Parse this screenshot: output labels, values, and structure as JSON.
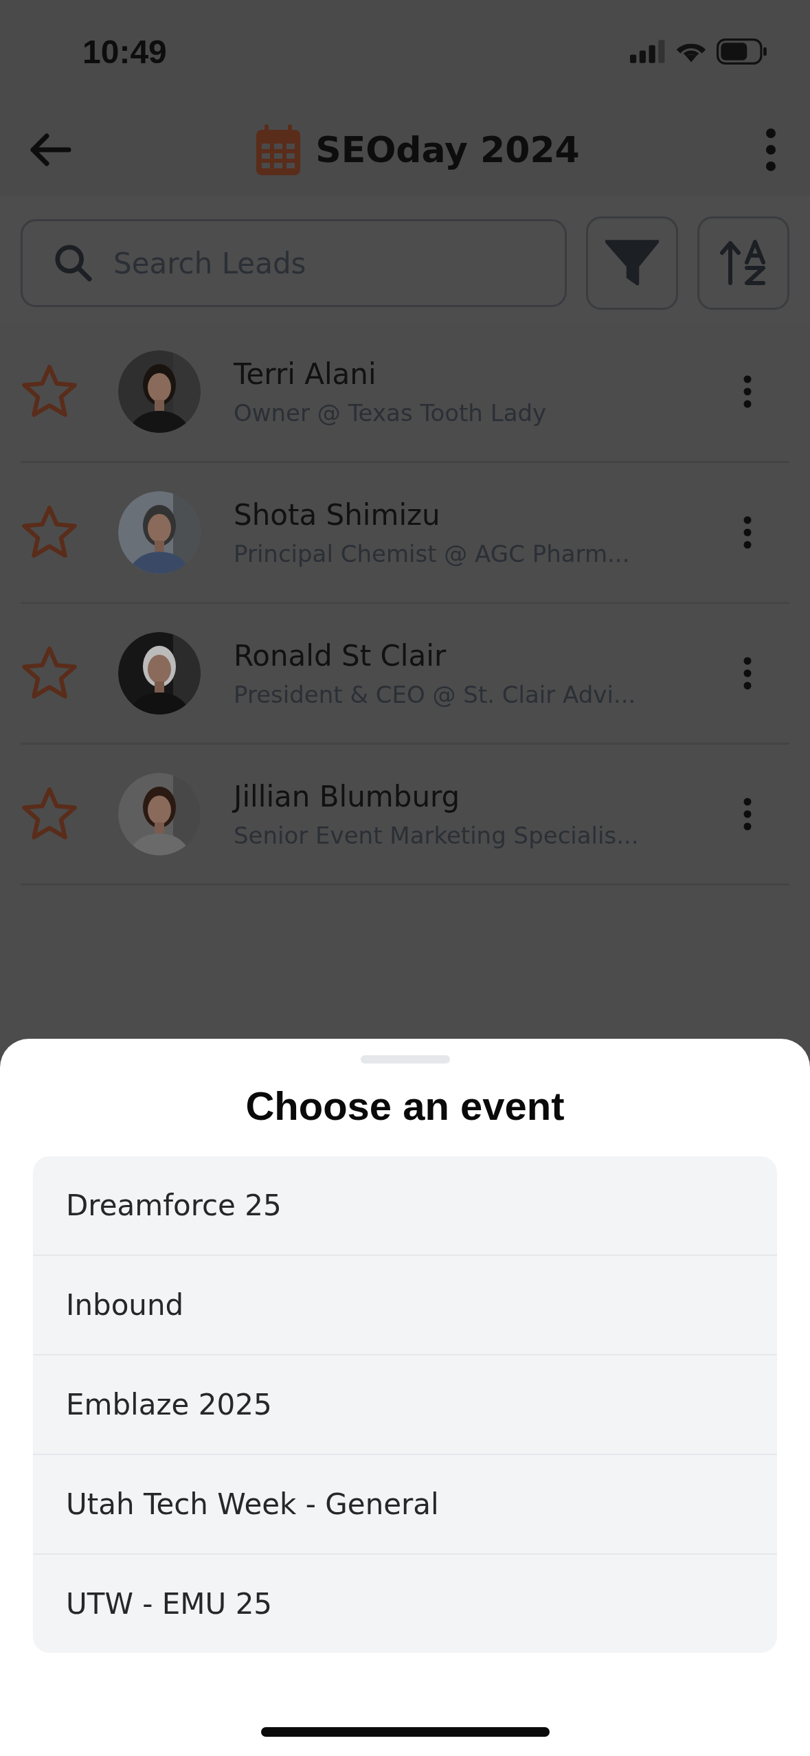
{
  "status_bar": {
    "time": "10:49"
  },
  "header": {
    "title": "SEOday 2024"
  },
  "search": {
    "placeholder": "Search Leads"
  },
  "leads": [
    {
      "name": "Terri Alani",
      "subtitle": "Owner @ Texas Tooth Lady",
      "starred": false
    },
    {
      "name": "Shota Shimizu",
      "subtitle": "Principal Chemist @ AGC Pharm...",
      "starred": false
    },
    {
      "name": "Ronald St Clair",
      "subtitle": "President & CEO @ St. Clair Advi...",
      "starred": false
    },
    {
      "name": "Jillian Blumburg",
      "subtitle": "Senior Event Marketing Specialis...",
      "starred": false
    }
  ],
  "sheet": {
    "title": "Choose an event",
    "options": [
      {
        "label": "Dreamforce 25"
      },
      {
        "label": "Inbound"
      },
      {
        "label": "Emblaze 2025"
      },
      {
        "label": "Utah Tech Week - General"
      },
      {
        "label": "UTW - EMU 25"
      }
    ]
  }
}
